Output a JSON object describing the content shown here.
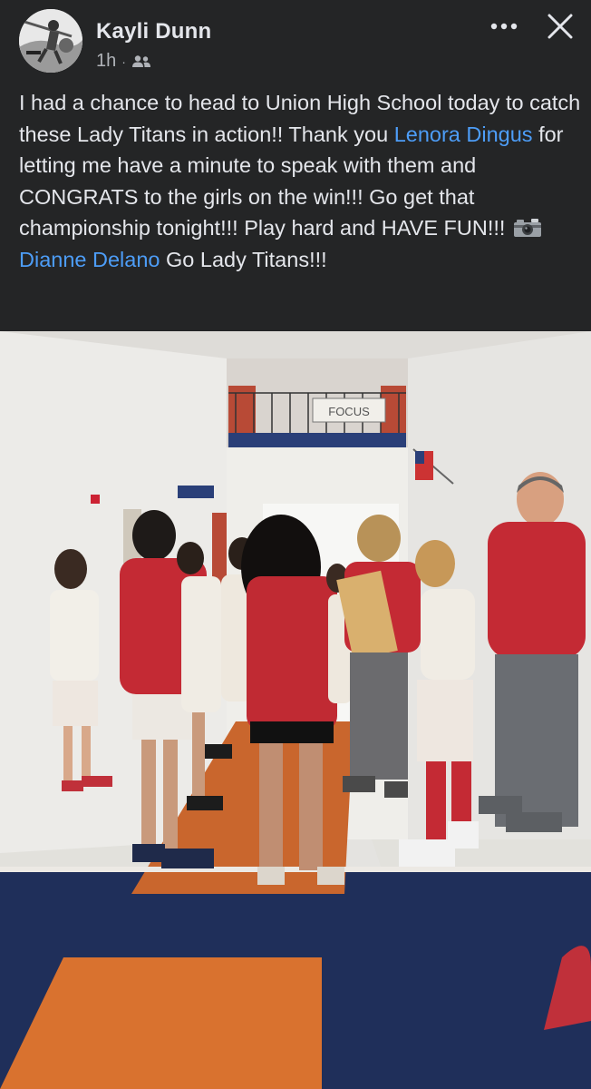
{
  "post": {
    "author": "Kayli Dunn",
    "timestamp": "1h",
    "separator": "·",
    "audience_icon": "friends-icon",
    "text_parts": [
      "I had a chance to head to Union High School today to catch these Lady Titans in action!! Thank you ",
      "Lenora Dingus",
      " for letting me have a minute to speak with them and CONGRATS to the girls on the win!!! Go get that championship tonight!!! Play hard and HAVE FUN!!! ",
      "Dianne Delano",
      " Go Lady Titans!!!"
    ],
    "mentions": [
      "Lenora Dingus",
      "Dianne Delano"
    ],
    "inline_emoji": "camera-with-flash-icon"
  },
  "header_actions": {
    "more_icon": "more-horizontal-icon",
    "close_icon": "close-icon"
  },
  "photo": {
    "banner_text": "FOCUS"
  },
  "colors": {
    "background": "#242526",
    "text": "#e4e6eb",
    "secondary_text": "#b0b3b8",
    "link": "#4d9df7"
  }
}
